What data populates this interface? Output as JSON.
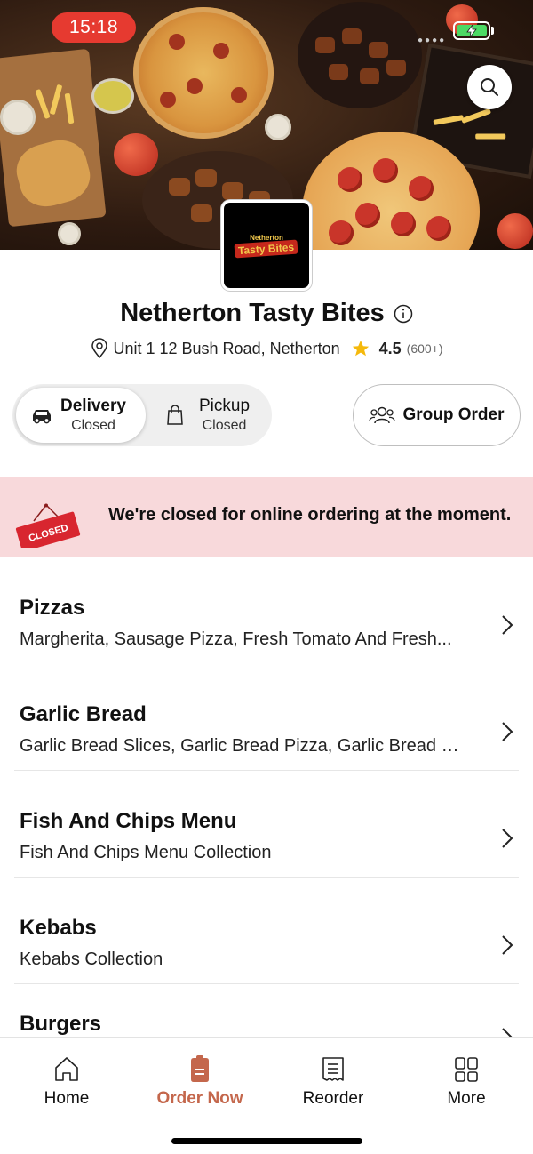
{
  "status_bar": {
    "time": "15:18"
  },
  "store": {
    "name": "Netherton Tasty Bites",
    "logo_line1": "Netherton",
    "logo_line2": "Tasty Bites",
    "address": "Unit 1 12 Bush Road, Netherton",
    "rating": "4.5",
    "rating_count": "(600+)"
  },
  "mode": {
    "delivery": {
      "label": "Delivery",
      "status": "Closed"
    },
    "pickup": {
      "label": "Pickup",
      "status": "Closed"
    },
    "group_order_label": "Group Order"
  },
  "closed_banner": {
    "sign_text": "CLOSED",
    "message": "We're closed for online ordering at the moment."
  },
  "menu": [
    {
      "name": "Pizzas",
      "desc": "Margherita, Sausage Pizza, Fresh Tomato And Fresh..."
    },
    {
      "name": "Garlic Bread",
      "desc": "Garlic Bread Slices, Garlic Bread Pizza, Garlic Bread Pi..."
    },
    {
      "name": "Fish And Chips Menu",
      "desc": "Fish And Chips Menu Collection"
    },
    {
      "name": "Kebabs",
      "desc": "Kebabs Collection"
    },
    {
      "name": "Burgers",
      "desc": ""
    }
  ],
  "tabbar": [
    {
      "label": "Home",
      "icon": "home-icon"
    },
    {
      "label": "Order Now",
      "icon": "order-bag-icon"
    },
    {
      "label": "Reorder",
      "icon": "receipt-icon"
    },
    {
      "label": "More",
      "icon": "grid-icon"
    }
  ],
  "colors": {
    "accent": "#c4674c",
    "closed_bg": "#f8d9db",
    "status_pill": "#e63a30",
    "closed_sign": "#d8262f"
  }
}
